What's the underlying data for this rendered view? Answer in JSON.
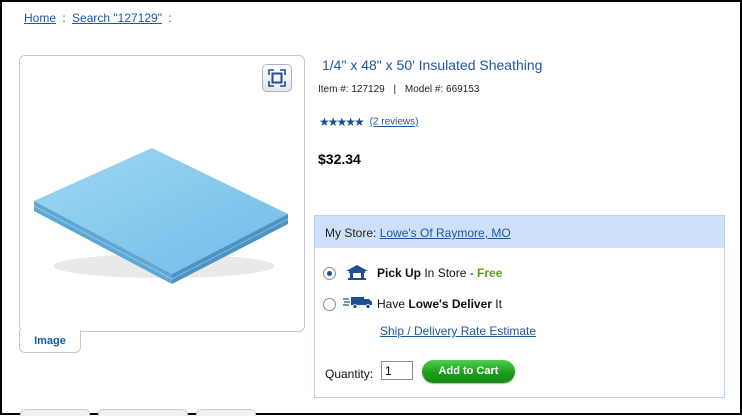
{
  "breadcrumb": {
    "home": "Home",
    "separator": ":",
    "search": "Search \"127129\"",
    "trail": ":"
  },
  "image_panel": {
    "tab_label": "Image",
    "zoom_icon": "expand-icon"
  },
  "product": {
    "title": "1/4\" x 48\" x 50' Insulated Sheathing",
    "item_label": "Item #:",
    "item_number": "127129",
    "meta_separator": "|",
    "model_label": "Model #:",
    "model_number": "669153",
    "stars": "★★★★★",
    "rating_value": 5,
    "reviews_link": "(2 reviews)",
    "price": "$32.34"
  },
  "store": {
    "label": "My Store:",
    "store_name": "Lowe's Of Raymore, MO",
    "option_pickup": {
      "bold": "Pick Up",
      "rest": " In Store - ",
      "free": "Free",
      "selected": true,
      "icon": "store-icon"
    },
    "option_deliver": {
      "prefix": "Have ",
      "bold": "Lowe's Deliver",
      "suffix": " It",
      "selected": false,
      "icon": "truck-icon"
    },
    "ship_link": "Ship / Delivery Rate Estimate",
    "quantity_label": "Quantity:",
    "quantity_value": "1",
    "add_to_cart": "Add to Cart"
  },
  "colors": {
    "link": "#1a57a6",
    "store_header_bg": "#cde0f8",
    "free_green": "#5a9e1b",
    "button_green": "#1c9d1c"
  }
}
